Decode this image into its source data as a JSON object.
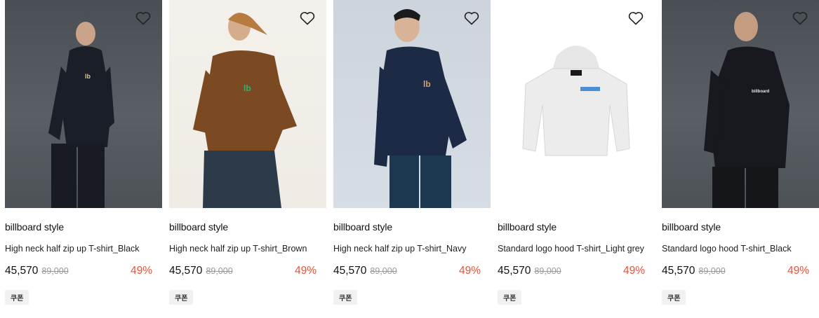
{
  "products": [
    {
      "brand": "billboard style",
      "name": "High neck half zip up T-shirt_Black",
      "price": "45,570",
      "original_price": "89,000",
      "discount": "49%",
      "coupon": "쿠폰",
      "bg": "dark",
      "garment_color": "#1a1e27"
    },
    {
      "brand": "billboard style",
      "name": "High neck half zip up T-shirt_Brown",
      "price": "45,570",
      "original_price": "89,000",
      "discount": "49%",
      "coupon": "쿠폰",
      "bg": "cream",
      "garment_color": "#7b4a22"
    },
    {
      "brand": "billboard style",
      "name": "High neck half zip up T-shirt_Navy",
      "price": "45,570",
      "original_price": "89,000",
      "discount": "49%",
      "coupon": "쿠폰",
      "bg": "blue",
      "garment_color": "#1d2a45"
    },
    {
      "brand": "billboard style",
      "name": "Standard logo hood T-shirt_Light grey",
      "price": "45,570",
      "original_price": "89,000",
      "discount": "49%",
      "coupon": "쿠폰",
      "bg": "white",
      "garment_color": "#ececec"
    },
    {
      "brand": "billboard style",
      "name": "Standard logo hood T-shirt_Black",
      "price": "45,570",
      "original_price": "89,000",
      "discount": "49%",
      "coupon": "쿠폰",
      "bg": "dark",
      "garment_color": "#17191e"
    }
  ],
  "colors": {
    "discount": "#e8533a",
    "strikethrough": "#999999"
  },
  "icons": {
    "wishlist": "heart-outline-icon"
  }
}
